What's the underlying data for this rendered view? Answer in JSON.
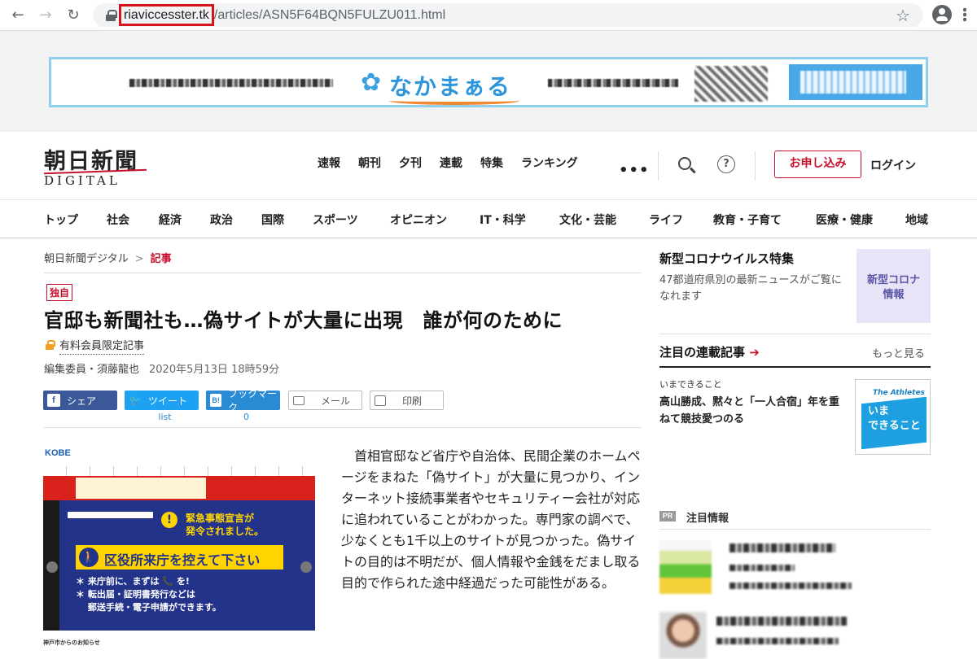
{
  "browser": {
    "back": "←",
    "forward": "→",
    "reload": "↻",
    "url_host": "riaviccesster.tk",
    "url_path": "/articles/ASN5F64BQN5FULZU011.html",
    "star": "☆"
  },
  "ad": {
    "logo": "なかまぁる",
    "flower": "✿"
  },
  "header": {
    "logo_main": "朝日新聞",
    "logo_sub": "DIGITAL",
    "topnav": [
      "速報",
      "朝刊",
      "夕刊",
      "連載",
      "特集",
      "ランキング"
    ],
    "more": "•••",
    "help": "?",
    "subscribe": "お申し込み",
    "login": "ログイン"
  },
  "catnav": [
    "トップ",
    "社会",
    "経済",
    "政治",
    "国際",
    "スポーツ",
    "オピニオン",
    "IT・科学",
    "文化・芸能",
    "ライフ",
    "教育・子育て",
    "医療・健康",
    "地域"
  ],
  "breadcrumb": {
    "home": "朝日新聞デジタル",
    "sep": ">",
    "current": "記事"
  },
  "article": {
    "badge": "独自",
    "headline": "官邸も新聞社も…偽サイトが大量に出現　誰が何のために",
    "paid": "有料会員限定記事",
    "author": "編集委員・須藤龍也",
    "date": "2020年5月13日 18時59分",
    "share": {
      "facebook": "シェア",
      "twitter": "ツイート",
      "hatena": "ブックマーク",
      "mail": "メール",
      "print": "印刷",
      "twitter_count": "list",
      "hatena_count": "0",
      "fb_icon": "f",
      "tw_icon": "🐦",
      "hb_icon": "B!"
    },
    "body": "　首相官邸など省庁や自治体、民間企業のホームページをまねた「偽サイト」が大量に見つかり、インターネット接続事業者やセキュリティー会社が対応に追われていることがわかった。専門家の調べで、少なくとも1千以上のサイトが見つかった。偽サイトの目的は不明だが、個人情報や金銭をだまし取る目的で作られた途中経過だった可能性がある。"
  },
  "image": {
    "kobe": "KOBE",
    "warn_mark": "!",
    "emergency_line1": "緊急事態宣言が",
    "emergency_line2": "発令されました。",
    "person": "🚶",
    "band_text": "区役所来庁を控えて下さい",
    "line1": "＊ 来庁前に、まずは 📞 を!",
    "line2": "＊ 転出届・証明書発行などは",
    "line3": "　 郵送手続・電子申請ができます。",
    "footer": "神戸市からのお知らせ"
  },
  "sidebar": {
    "feature_title": "新型コロナウイルス特集",
    "feature_desc": "47都道府県別の最新ニュースがご覧になれます",
    "feature_thumb": "新型コロナ\n情報",
    "series_title": "注目の連載記事",
    "series_arrow": "➔",
    "more": "もっと見る",
    "kicker": "いまできること",
    "item": "高山勝成、黙々と「一人合宿」年を重ねて競技愛つのる",
    "athletes_brand": "The Athletes",
    "athletes_text": "いま\nできること",
    "pr_badge": "PR",
    "pr_title": "注目情報"
  }
}
